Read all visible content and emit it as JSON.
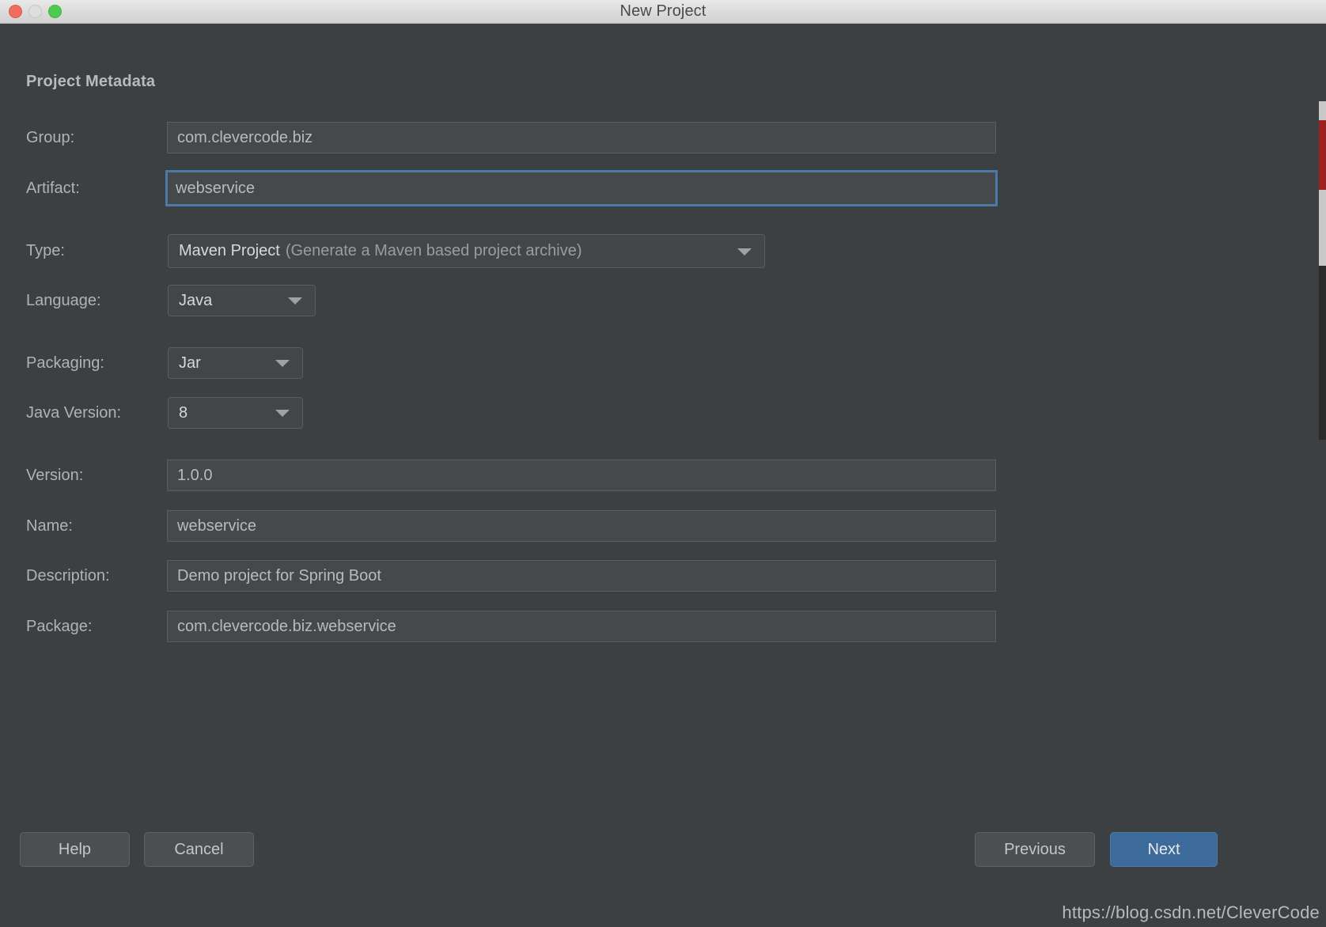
{
  "window": {
    "title": "New Project",
    "traffic_lights": [
      "close-button",
      "minimize-button",
      "zoom-button"
    ]
  },
  "section": {
    "title": "Project Metadata"
  },
  "fields": {
    "group": {
      "label": "Group:",
      "value": "com.clevercode.biz"
    },
    "artifact": {
      "label": "Artifact:",
      "value": "webservice",
      "focused": true
    },
    "type": {
      "label": "Type:",
      "value_primary": "Maven Project",
      "value_secondary": "(Generate a Maven based project archive)"
    },
    "language": {
      "label": "Language:",
      "value": "Java"
    },
    "packaging": {
      "label": "Packaging:",
      "value": "Jar"
    },
    "java_version": {
      "label": "Java Version:",
      "value": "8"
    },
    "version": {
      "label": "Version:",
      "value": "1.0.0"
    },
    "name": {
      "label": "Name:",
      "value": "webservice"
    },
    "description": {
      "label": "Description:",
      "value": "Demo project for Spring Boot"
    },
    "package": {
      "label": "Package:",
      "value": "com.clevercode.biz.webservice"
    }
  },
  "buttons": {
    "help": "Help",
    "cancel": "Cancel",
    "previous": "Previous",
    "next": "Next"
  },
  "watermark": "https://blog.csdn.net/CleverCode",
  "colors": {
    "dialog_bg": "#3c4043",
    "titlebar_bg": "#dcdcdc",
    "field_bg": "#45494c",
    "accent": "#3c6a9b",
    "focus_border": "#4b7aa8",
    "text": "#b8bbbd"
  }
}
